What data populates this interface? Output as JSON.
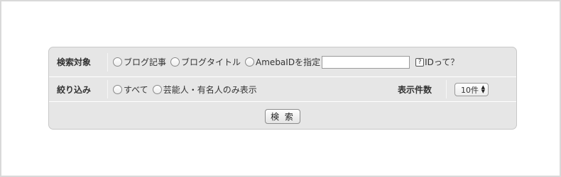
{
  "search_target": {
    "label": "検索対象",
    "options": [
      "ブログ記事",
      "ブログタイトル",
      "AmebaIDを指定"
    ],
    "id_input_value": "",
    "help_icon_glyph": "?",
    "help_text": "IDって？"
  },
  "filter": {
    "label": "絞り込み",
    "options": [
      "すべて",
      "芸能人・有名人のみ表示"
    ]
  },
  "count": {
    "label": "表示件数",
    "selected": "10件"
  },
  "search_button": {
    "label": "検 索"
  }
}
